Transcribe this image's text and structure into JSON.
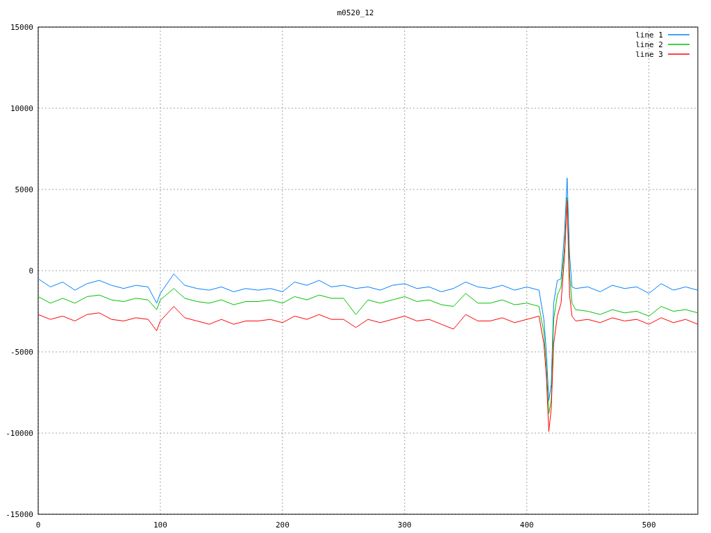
{
  "chart_data": {
    "type": "line",
    "title": "m0520_12",
    "grid": true,
    "legend": true,
    "xlim": [
      0,
      540
    ],
    "ylim": [
      -15000,
      15000
    ],
    "xticks": [
      0,
      100,
      200,
      300,
      400,
      500
    ],
    "yticks": [
      -15000,
      -10000,
      -5000,
      0,
      5000,
      10000,
      15000
    ],
    "x": [
      0,
      10,
      20,
      30,
      40,
      50,
      60,
      70,
      80,
      90,
      97,
      100,
      111,
      120,
      130,
      140,
      150,
      160,
      170,
      180,
      190,
      200,
      210,
      220,
      230,
      240,
      250,
      260,
      270,
      280,
      290,
      300,
      310,
      320,
      330,
      340,
      350,
      360,
      370,
      380,
      390,
      400,
      410,
      414,
      416,
      418,
      420,
      422,
      425,
      428,
      431,
      433,
      435,
      437,
      440,
      450,
      460,
      470,
      480,
      490,
      500,
      510,
      520,
      530,
      540
    ],
    "series": [
      {
        "name": "line 1",
        "color": "#0080ff",
        "values": [
          -500,
          -1000,
          -700,
          -1200,
          -800,
          -600,
          -900,
          -1100,
          -900,
          -1000,
          -2000,
          -1400,
          -200,
          -900,
          -1100,
          -1200,
          -1000,
          -1300,
          -1100,
          -1200,
          -1100,
          -1300,
          -700,
          -900,
          -600,
          -1000,
          -900,
          -1100,
          -1000,
          -1200,
          -900,
          -800,
          -1100,
          -1000,
          -1300,
          -1100,
          -700,
          -1000,
          -1100,
          -900,
          -1200,
          -1000,
          -1200,
          -3000,
          -5000,
          -8000,
          -7000,
          -2000,
          -600,
          -500,
          2500,
          5700,
          1000,
          -1000,
          -1100,
          -1000,
          -1300,
          -900,
          -1100,
          -1000,
          -1400,
          -800,
          -1200,
          -1000,
          -1200
        ]
      },
      {
        "name": "line 2",
        "color": "#00c000",
        "values": [
          -1600,
          -2000,
          -1700,
          -2000,
          -1600,
          -1500,
          -1800,
          -1900,
          -1700,
          -1800,
          -2400,
          -1800,
          -1100,
          -1700,
          -1900,
          -2000,
          -1800,
          -2100,
          -1900,
          -1900,
          -1800,
          -2000,
          -1600,
          -1800,
          -1500,
          -1700,
          -1700,
          -2700,
          -1800,
          -2000,
          -1800,
          -1600,
          -1900,
          -1800,
          -2100,
          -2200,
          -1400,
          -2000,
          -2000,
          -1800,
          -2100,
          -2000,
          -2200,
          -3800,
          -6000,
          -8800,
          -8000,
          -3000,
          -1500,
          -1000,
          1500,
          4500,
          -200,
          -2000,
          -2400,
          -2500,
          -2700,
          -2400,
          -2600,
          -2500,
          -2800,
          -2200,
          -2500,
          -2400,
          -2600
        ]
      },
      {
        "name": "line 3",
        "color": "#ff0000",
        "values": [
          -2700,
          -3000,
          -2800,
          -3100,
          -2700,
          -2600,
          -3000,
          -3100,
          -2900,
          -3000,
          -3700,
          -3100,
          -2200,
          -2900,
          -3100,
          -3300,
          -3000,
          -3300,
          -3100,
          -3100,
          -3000,
          -3200,
          -2800,
          -3000,
          -2700,
          -3000,
          -3000,
          -3500,
          -3000,
          -3200,
          -3000,
          -2800,
          -3100,
          -3000,
          -3300,
          -3600,
          -2700,
          -3100,
          -3100,
          -2900,
          -3200,
          -3000,
          -2800,
          -4500,
          -6500,
          -9900,
          -8500,
          -4500,
          -2800,
          -2000,
          1000,
          4300,
          -1500,
          -2800,
          -3100,
          -3000,
          -3200,
          -2900,
          -3100,
          -3000,
          -3300,
          -2900,
          -3200,
          -3000,
          -3300
        ]
      }
    ]
  }
}
